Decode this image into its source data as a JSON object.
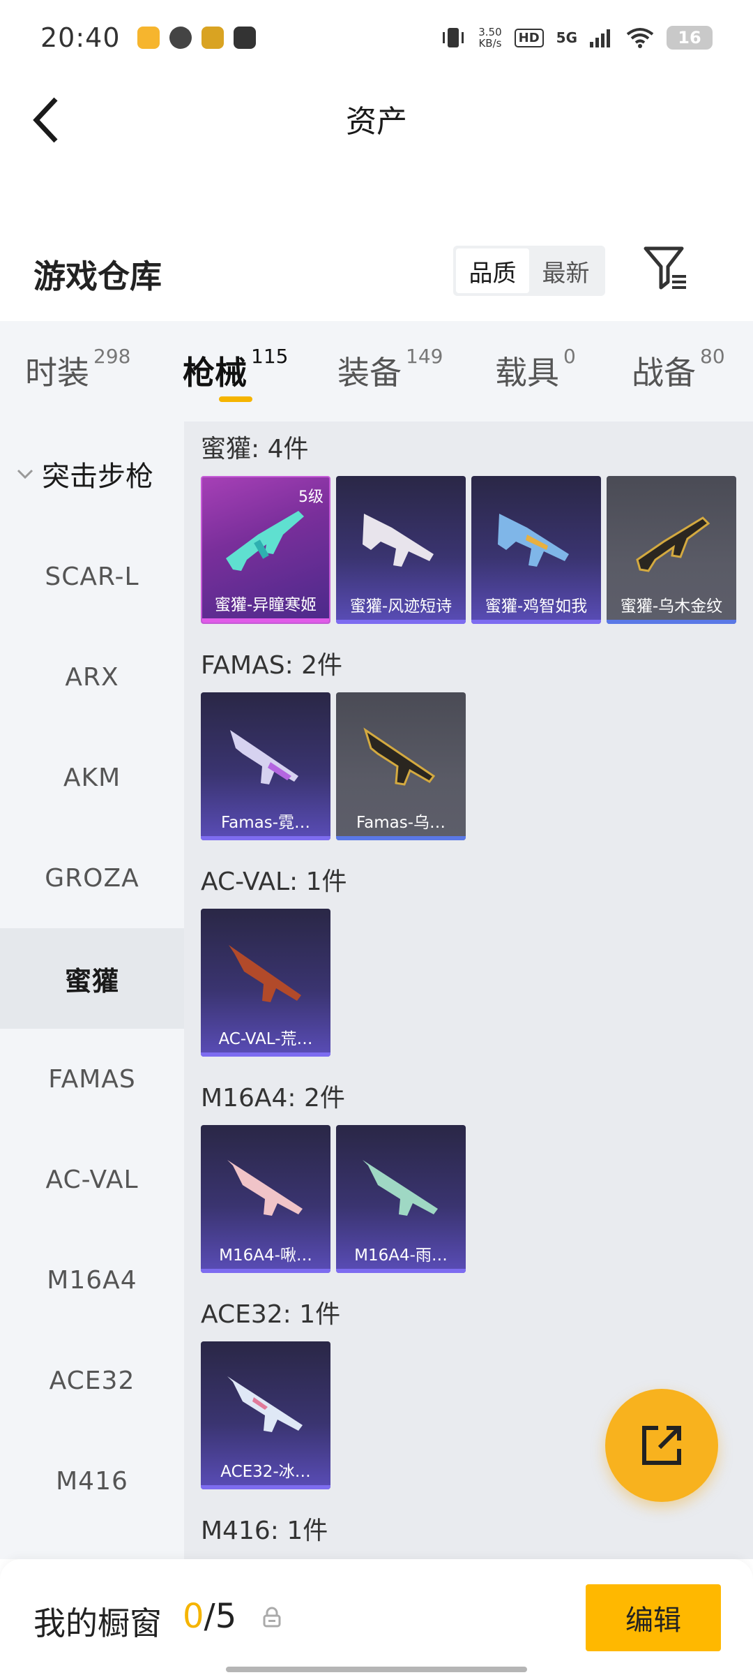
{
  "status_bar": {
    "time": "20:40",
    "speed_value": "3.50",
    "speed_unit": "KB/s",
    "hd_label": "HD",
    "network": "5G",
    "battery": "16"
  },
  "header": {
    "title": "资产"
  },
  "warehouse": {
    "title": "游戏仓库",
    "sort_options": [
      "品质",
      "最新"
    ]
  },
  "tabs": [
    {
      "label": "时装",
      "count": "298"
    },
    {
      "label": "枪械",
      "count": "115"
    },
    {
      "label": "装备",
      "count": "149"
    },
    {
      "label": "载具",
      "count": "0"
    },
    {
      "label": "战备",
      "count": "80"
    }
  ],
  "sidebar": {
    "category": "突击步枪",
    "items": [
      "SCAR-L",
      "ARX",
      "AKM",
      "GROZA",
      "蜜獾",
      "FAMAS",
      "AC-VAL",
      "M16A4",
      "ACE32",
      "M416"
    ]
  },
  "groups": [
    {
      "title": "蜜獾: 4件",
      "items": [
        {
          "name": "蜜獾-异瞳寒姬",
          "level": "5级"
        },
        {
          "name": "蜜獾-风迹短诗"
        },
        {
          "name": "蜜獾-鸡智如我"
        },
        {
          "name": "蜜獾-乌木金纹"
        }
      ]
    },
    {
      "title": "FAMAS: 2件",
      "items": [
        {
          "name": "Famas-霓…"
        },
        {
          "name": "Famas-乌…"
        }
      ]
    },
    {
      "title": "AC-VAL: 1件",
      "items": [
        {
          "name": "AC-VAL-荒…"
        }
      ]
    },
    {
      "title": "M16A4: 2件",
      "items": [
        {
          "name": "M16A4-啾…"
        },
        {
          "name": "M16A4-雨…"
        }
      ]
    },
    {
      "title": "ACE32: 1件",
      "items": [
        {
          "name": "ACE32-冰…"
        }
      ]
    },
    {
      "title": "M416: 1件",
      "items": []
    }
  ],
  "bottom_bar": {
    "showcase_label": "我的橱窗",
    "showcase_current": "0",
    "showcase_total": "/5",
    "edit_label": "编辑"
  },
  "icons": {
    "back": "back-arrow-icon",
    "filter": "filter-icon",
    "share": "share-external-icon",
    "lock": "lock-icon",
    "chevron": "chevron-down-icon"
  },
  "colors": {
    "accent": "#f5b400",
    "fab": "#f8b21e",
    "edit_button": "#ffb800"
  }
}
